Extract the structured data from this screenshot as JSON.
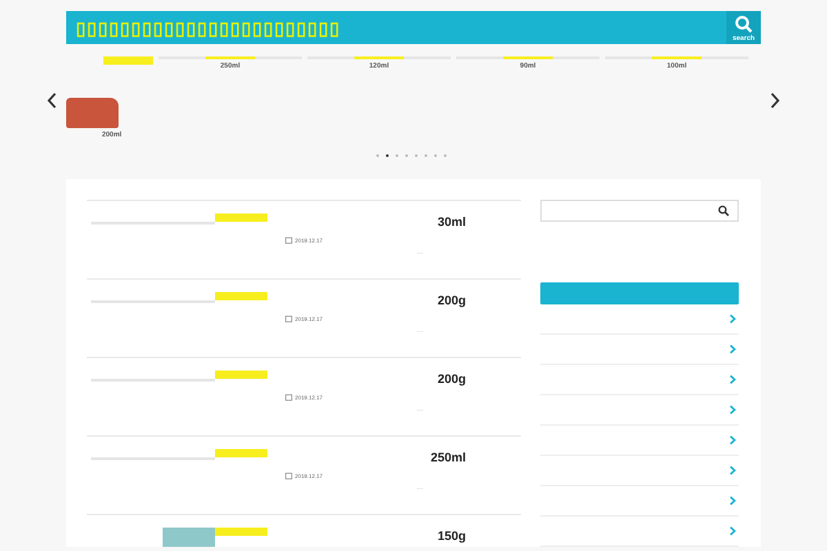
{
  "header": {
    "title": "▯▯▯▯▯▯▯▯▯▯▯▯▯▯▯▯▯▯▯▯▯▯▯▯",
    "search_label": "search"
  },
  "carousel": {
    "slides": [
      {
        "label": "250ml"
      },
      {
        "label": "120ml"
      },
      {
        "label": "90ml"
      },
      {
        "label": "100ml"
      }
    ],
    "feature": {
      "label": "200ml"
    },
    "dots": [
      {
        "selected": false
      },
      {
        "selected": true
      },
      {
        "selected": false
      },
      {
        "selected": false
      },
      {
        "selected": false
      },
      {
        "selected": false
      },
      {
        "selected": false
      },
      {
        "selected": false
      }
    ]
  },
  "posts": [
    {
      "title": "30ml",
      "date": "2019.12.17",
      "excerpt": "…",
      "thumbnail": false
    },
    {
      "title": "200g",
      "date": "2019.12.17",
      "excerpt": "…",
      "thumbnail": false
    },
    {
      "title": "200g",
      "date": "2019.12.17",
      "excerpt": "…",
      "thumbnail": false
    },
    {
      "title": "250ml",
      "date": "2019.12.17",
      "excerpt": "…",
      "thumbnail": false
    },
    {
      "title": "150g",
      "thumbnail": true
    }
  ]
}
